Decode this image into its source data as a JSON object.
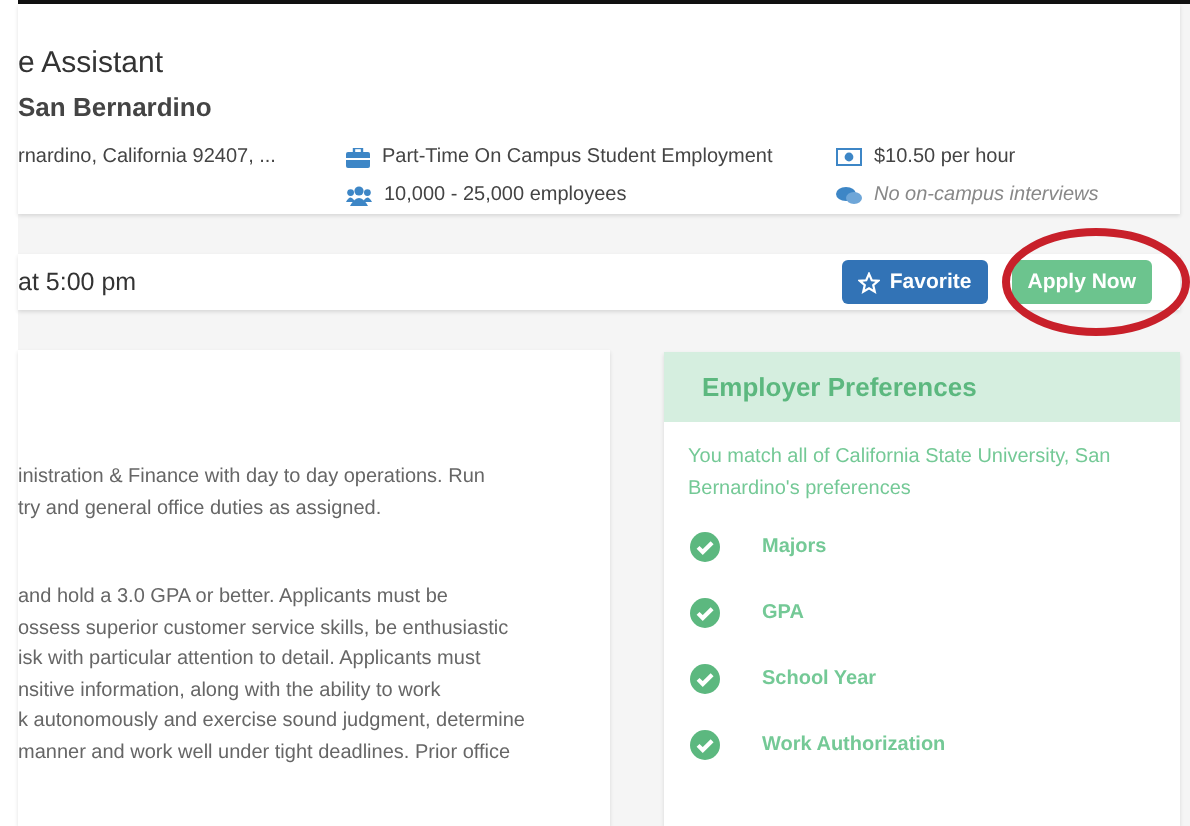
{
  "job": {
    "title": "e Assistant",
    "employer": "San Bernardino",
    "location": "rnardino, California 92407, ...",
    "details": [
      {
        "kind": "briefcase",
        "text": "Part-Time On Campus Student Employment",
        "italic": false
      },
      {
        "kind": "money",
        "text": "$10.50 per hour",
        "italic": false
      },
      {
        "kind": "people",
        "text": "10,000 - 25,000 employees",
        "italic": false
      },
      {
        "kind": "chat",
        "text": "No on-campus interviews",
        "italic": true
      }
    ]
  },
  "deadline": "at 5:00 pm",
  "buttons": [
    {
      "kind": "favorite",
      "label": "Favorite",
      "highlighted": false
    },
    {
      "kind": "apply",
      "label": "Apply Now",
      "highlighted": true
    }
  ],
  "description": {
    "paragraphs": [
      [
        "inistration & Finance with day to day operations. Run",
        "try and general office duties as assigned."
      ],
      [
        "and hold a 3.0 GPA or better. Applicants must be",
        "ossess superior customer service skills, be enthusiastic",
        "isk with particular attention to detail. Applicants must",
        "nsitive information, along with the ability to work",
        "k autonomously and exercise sound judgment, determine",
        "manner and work well under tight deadlines. Prior office"
      ]
    ]
  },
  "preferences": {
    "title": "Employer Preferences",
    "summary": "You match all of California State University, San Bernardino's preferences",
    "items": [
      {
        "label": "Majors",
        "matched": true
      },
      {
        "label": "GPA",
        "matched": true
      },
      {
        "label": "School Year",
        "matched": true
      },
      {
        "label": "Work Authorization",
        "matched": true
      }
    ]
  }
}
